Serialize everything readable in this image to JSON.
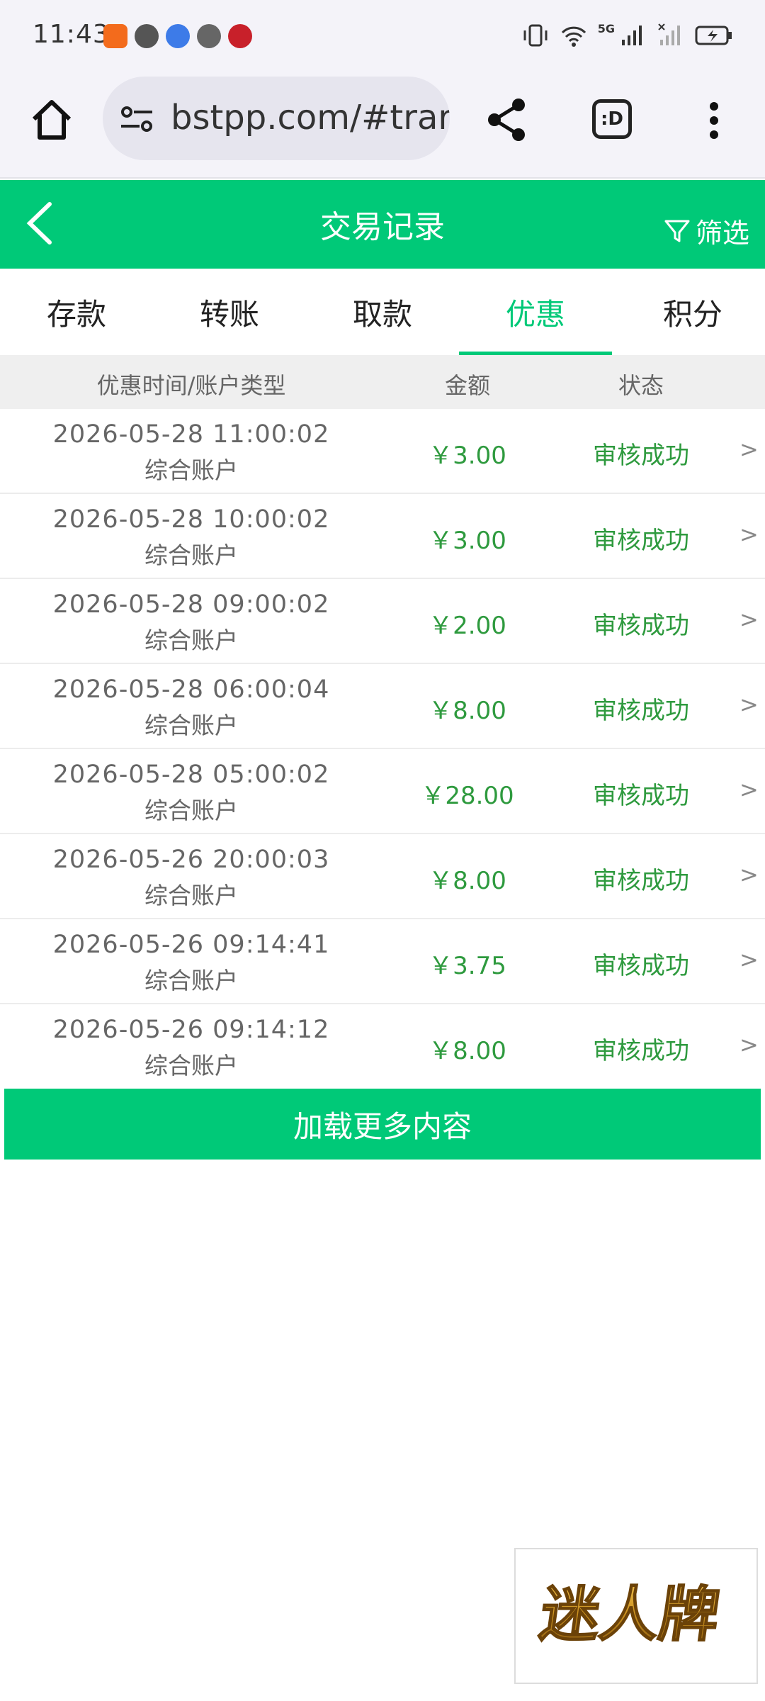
{
  "status_bar": {
    "time": "11:43",
    "network": "5G"
  },
  "browser": {
    "url": "bstpp.com/#trar",
    "tabs_label": ":D"
  },
  "header": {
    "title": "交易记录",
    "filter_label": "筛选"
  },
  "tabs": [
    {
      "label": "存款",
      "active": false
    },
    {
      "label": "转账",
      "active": false
    },
    {
      "label": "取款",
      "active": false
    },
    {
      "label": "优惠",
      "active": true
    },
    {
      "label": "积分",
      "active": false
    }
  ],
  "table": {
    "columns": [
      "优惠时间/账户类型",
      "金额",
      "状态"
    ],
    "rows": [
      {
        "datetime": "2026-05-28 11:00:02",
        "account": "综合账户",
        "amount": "￥3.00",
        "status": "审核成功"
      },
      {
        "datetime": "2026-05-28 10:00:02",
        "account": "综合账户",
        "amount": "￥3.00",
        "status": "审核成功"
      },
      {
        "datetime": "2026-05-28 09:00:02",
        "account": "综合账户",
        "amount": "￥2.00",
        "status": "审核成功"
      },
      {
        "datetime": "2026-05-28 06:00:04",
        "account": "综合账户",
        "amount": "￥8.00",
        "status": "审核成功"
      },
      {
        "datetime": "2026-05-28 05:00:02",
        "account": "综合账户",
        "amount": "￥28.00",
        "status": "审核成功"
      },
      {
        "datetime": "2026-05-26 20:00:03",
        "account": "综合账户",
        "amount": "￥8.00",
        "status": "审核成功"
      },
      {
        "datetime": "2026-05-26 09:14:41",
        "account": "综合账户",
        "amount": "￥3.75",
        "status": "审核成功"
      },
      {
        "datetime": "2026-05-26 09:14:12",
        "account": "综合账户",
        "amount": "￥8.00",
        "status": "审核成功"
      }
    ],
    "row_arrow": ">"
  },
  "load_more_label": "加载更多内容",
  "ad": {
    "text": "迷人牌"
  },
  "colors": {
    "brand_green": "#00c978",
    "amount_green": "#2e9a3e",
    "ad_gold": "#c9901f"
  }
}
